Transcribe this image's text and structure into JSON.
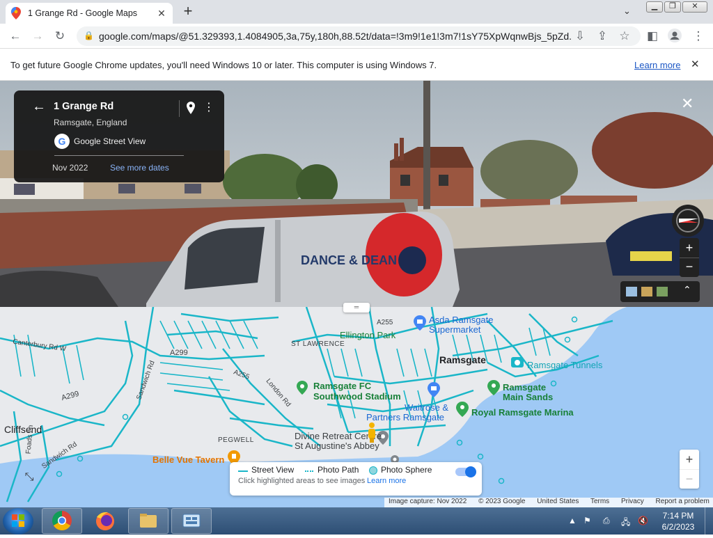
{
  "browser": {
    "tab_title": "1 Grange Rd - Google Maps",
    "url": "google.com/maps/@51.329393,1.4084905,3a,75y,180h,88.52t/data=!3m9!1e1!3m7!1sY75XpWqnwBjs_5pZd...",
    "info_message": "To get future Google Chrome updates, you'll need Windows 10 or later. This computer is using Windows 7.",
    "info_link": "Learn more"
  },
  "street_view": {
    "title": "1 Grange Rd",
    "subtitle": "Ramsgate, England",
    "source": "Google Street View",
    "date": "Nov 2022",
    "more_dates": "See more dates",
    "van_brand": "DANCE & DEAN"
  },
  "map": {
    "labels": {
      "canterbury_rd": "Canterbury Rd W",
      "a299_1": "A299",
      "a299_2": "A299",
      "a255_1": "A255",
      "a255_2": "A255",
      "sandwich_rd": "Sandwich Rd",
      "london_rd": "London Rd",
      "st_lawrence": "ST LAWRENCE",
      "ellington_park": "Ellington Park",
      "ramsgate": "Ramsgate",
      "cliffsend": "Cliffsend",
      "pegwell": "PEGWELL",
      "ramsgate_fc": "Ramsgate FC",
      "southwood_stadium": "Southwood Stadium",
      "asda1": "Asda Ramsgate",
      "asda2": "Supermarket",
      "ramsgate_tunnels": "Ramsgate Tunnels",
      "main_sands1": "Ramsgate",
      "main_sands2": "Main Sands",
      "waitrose1": "Waitrose &",
      "waitrose2": "Partners Ramsgate",
      "marina": "Royal Ramsgate Marina",
      "divine1": "Divine Retreat Centre",
      "divine2": "St Augustine's Abbey",
      "belle_vue": "Belle Vue Tavern",
      "foads": "Foads Ln",
      "sandwich_rd2": "Sandwich Rd"
    },
    "legend": {
      "street_view": "Street View",
      "photo_path": "Photo Path",
      "photo_sphere": "Photo Sphere",
      "hint": "Click highlighted areas to see images",
      "learn_more": "Learn more"
    },
    "attribution": {
      "capture": "Image capture: Nov 2022",
      "copyright": "© 2023 Google",
      "country": "United States",
      "terms": "Terms",
      "privacy": "Privacy",
      "report": "Report a problem"
    }
  },
  "taskbar": {
    "time": "7:14 PM",
    "date": "6/2/2023"
  },
  "colors": {
    "coverage": "#1ab6c8",
    "land": "#e8eaed",
    "water": "#9fc9f5"
  }
}
